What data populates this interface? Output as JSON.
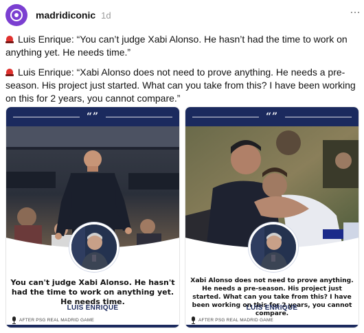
{
  "post": {
    "username": "madridiconic",
    "time": "1d",
    "more": "…",
    "paragraphs": [
      "Luis Enrique: “You can’t judge Xabi Alonso. He hasn’t had the time to work on anything yet. He needs time.”",
      "Luis Enrique: “Xabi Alonso does not need to prove anything. He needs a pre-season. His project just started. What can you take from this? I have been working on this for 2 years, you cannot compare.”"
    ]
  },
  "cards": [
    {
      "quote_mark": "“”",
      "quote": "You can't judge Xabi Alonso. He hasn't had the time to work on anything yet. He needs time.",
      "speaker": "LUIS ENRIQUE",
      "source": "AFTER PSG REAL MADRID GAME"
    },
    {
      "quote_mark": "“”",
      "quote": "Xabi Alonso does not need to prove anything. He needs a pre-season. His project just started. What can you take from this? I have been working on this for 2 years, you cannot compare.",
      "speaker": "LUIS ENRIQUE",
      "source": "AFTER PSG REAL MADRID GAME"
    }
  ],
  "colors": {
    "avatar": "#7b3fd1",
    "band": "#1b2a5e",
    "siren": "#e0312e"
  },
  "icons": [
    "logo-icon",
    "siren-icon",
    "more-icon",
    "mic-icon"
  ]
}
